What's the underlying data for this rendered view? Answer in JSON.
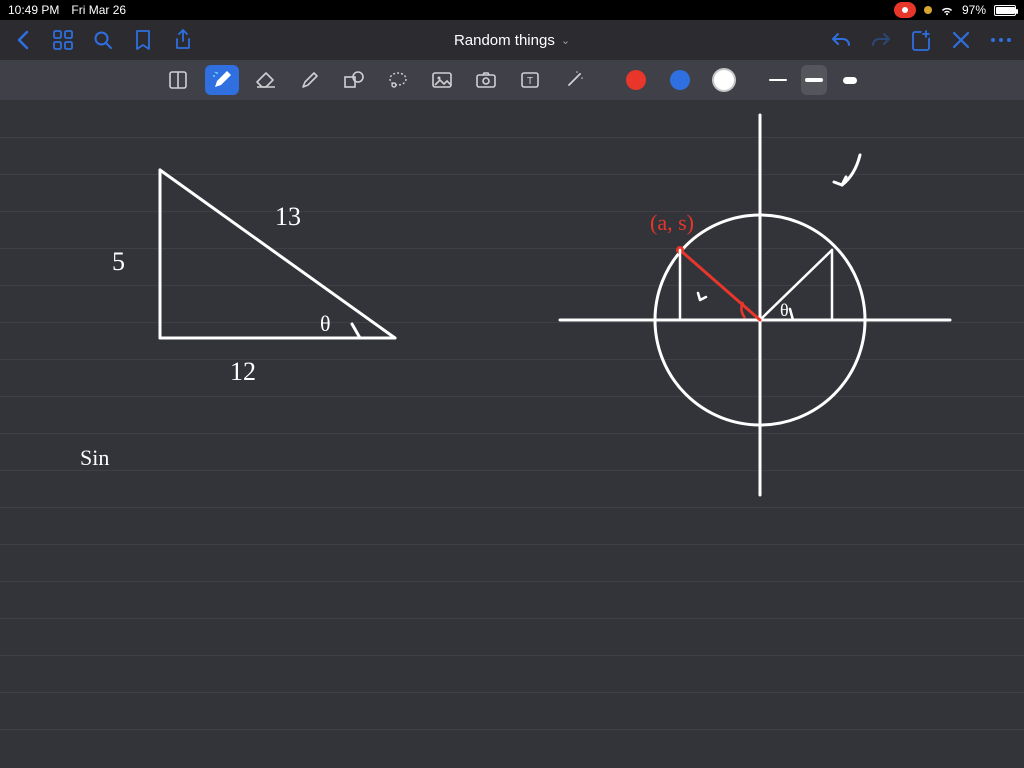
{
  "status": {
    "time": "10:49 PM",
    "date": "Fri Mar 26",
    "battery_pct": "97%"
  },
  "document": {
    "title": "Random things"
  },
  "colors": {
    "accent_blue": "#2f6fe0",
    "red": "#e8362a",
    "white": "#ffffff",
    "canvas": "#33333a"
  },
  "annotations": {
    "triangle": {
      "side_a": "5",
      "side_b": "12",
      "hypotenuse": "13",
      "angle_label": "θ"
    },
    "unit_circle": {
      "point_label": "(a, s)",
      "angle_label": "θ"
    },
    "other_text": {
      "sin": "Sin"
    }
  },
  "tools": {
    "selected_tool": "pen",
    "selected_color": "white",
    "selected_stroke": "medium"
  }
}
